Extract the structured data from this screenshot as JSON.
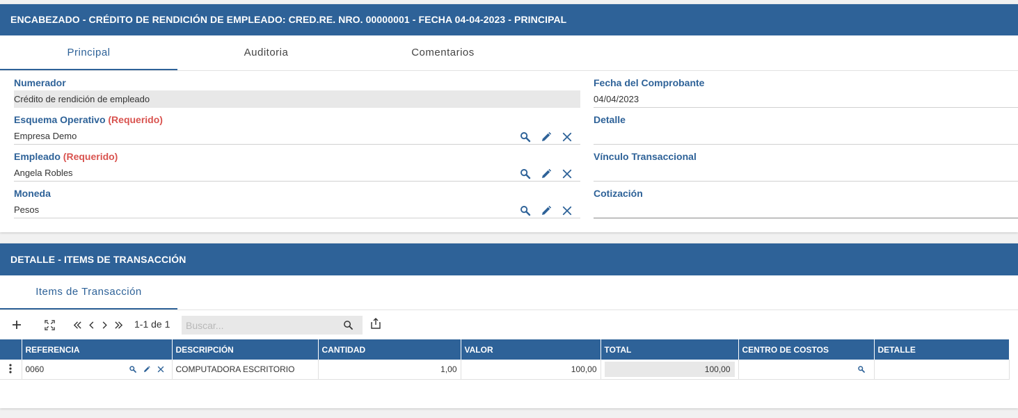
{
  "header_card": {
    "title": "ENCABEZADO - CRÉDITO DE RENDICIÓN DE EMPLEADO: CRED.RE. NRO. 00000001 - FECHA 04-04-2023 - PRINCIPAL",
    "tabs": [
      {
        "label": "Principal"
      },
      {
        "label": "Auditoria"
      },
      {
        "label": "Comentarios"
      }
    ],
    "fields": {
      "numerador": {
        "label": "Numerador",
        "value": "Crédito de rendición de empleado"
      },
      "esquema": {
        "label": "Esquema Operativo",
        "required": "(Requerido)",
        "value": "Empresa Demo"
      },
      "empleado": {
        "label": "Empleado",
        "required": "(Requerido)",
        "value": "Angela Robles"
      },
      "moneda": {
        "label": "Moneda",
        "value": "Pesos"
      },
      "fecha": {
        "label": "Fecha del Comprobante",
        "value": "04/04/2023"
      },
      "detalle": {
        "label": "Detalle",
        "value": ""
      },
      "vinculo": {
        "label": "Vínculo Transaccional",
        "value": ""
      },
      "cotizacion": {
        "label": "Cotización",
        "value": ""
      }
    }
  },
  "detail_card": {
    "title": "DETALLE - ITEMS DE TRANSACCIÓN",
    "tabs": [
      {
        "label": "Items de Transacción"
      }
    ],
    "toolbar": {
      "pagination": "1-1 de 1",
      "search_placeholder": "Buscar..."
    },
    "table": {
      "headers": [
        "REFERENCIA",
        "DESCRIPCIÓN",
        "CANTIDAD",
        "VALOR",
        "TOTAL",
        "CENTRO DE COSTOS",
        "DETALLE"
      ],
      "rows": [
        {
          "referencia": "0060",
          "descripcion": "COMPUTADORA ESCRITORIO",
          "cantidad": "1,00",
          "valor": "100,00",
          "total": "100,00",
          "centro": "",
          "detalle": ""
        }
      ]
    }
  },
  "colors": {
    "primary": "#2e6298",
    "required": "#d9534f"
  }
}
